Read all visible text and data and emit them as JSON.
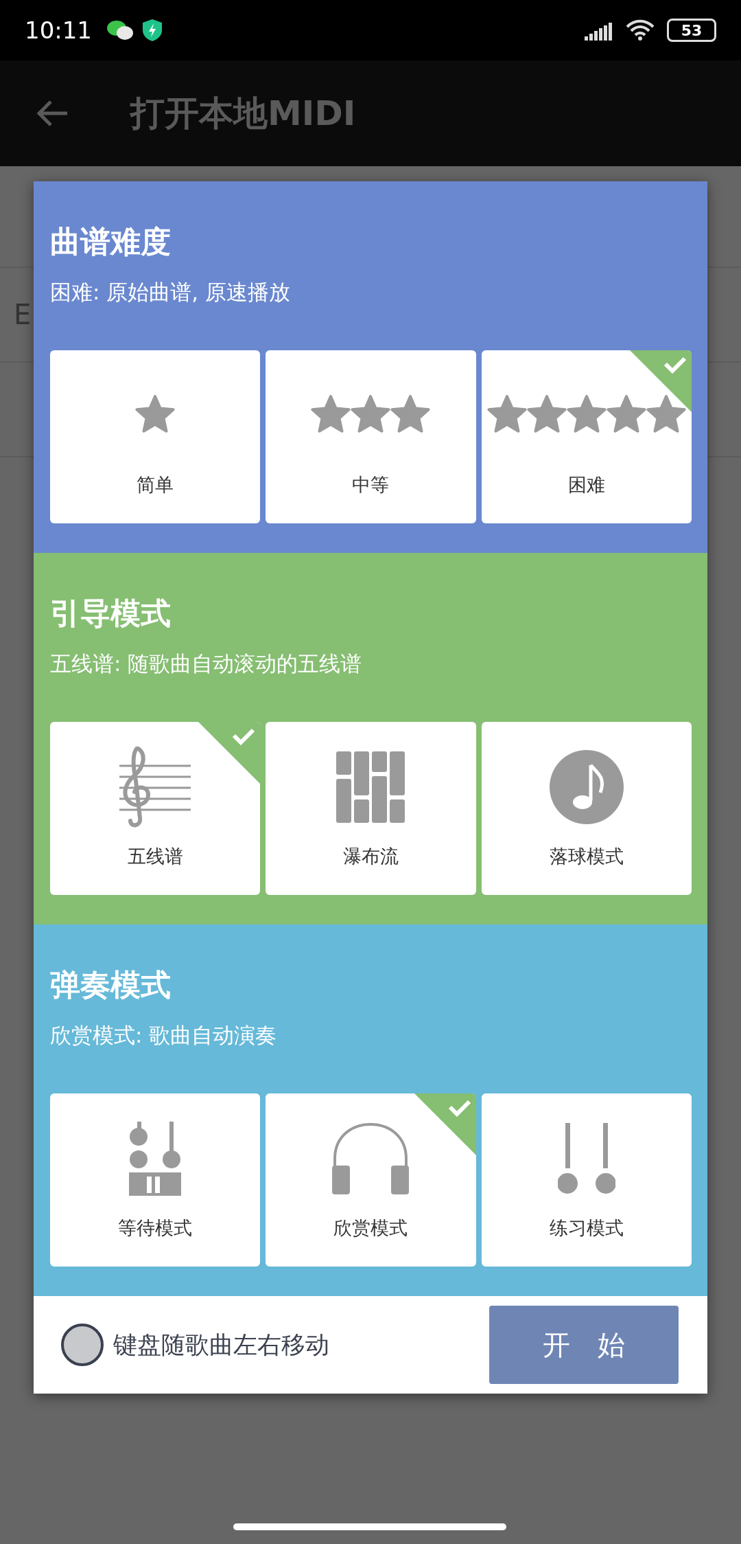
{
  "status_bar": {
    "time": "10:11",
    "battery": "53"
  },
  "app_bar": {
    "title": "打开本地MIDI"
  },
  "background_list": [
    {
      "text": "E"
    }
  ],
  "dialog": {
    "sections": [
      {
        "title": "曲谱难度",
        "description": "困难: 原始曲谱, 原速播放",
        "color": "#6a88cf",
        "options": [
          {
            "label": "简单",
            "kind": "onestar",
            "selected": false
          },
          {
            "label": "中等",
            "kind": "threestars",
            "selected": false
          },
          {
            "label": "困难",
            "kind": "fivestars",
            "selected": true
          }
        ]
      },
      {
        "title": "引导模式",
        "description": "五线谱: 随歌曲自动滚动的五线谱",
        "color": "#86be72",
        "options": [
          {
            "label": "五线谱",
            "kind": "staff",
            "selected": true
          },
          {
            "label": "瀑布流",
            "kind": "waterfall",
            "selected": false
          },
          {
            "label": "落球模式",
            "kind": "ball",
            "selected": false
          }
        ]
      },
      {
        "title": "弹奏模式",
        "description": "欣赏模式: 歌曲自动演奏",
        "color": "#66b9d8",
        "options": [
          {
            "label": "等待模式",
            "kind": "wait",
            "selected": false
          },
          {
            "label": "欣赏模式",
            "kind": "listen",
            "selected": true
          },
          {
            "label": "练习模式",
            "kind": "practice",
            "selected": false
          }
        ]
      }
    ],
    "toggle": {
      "label": "键盘随歌曲左右移动",
      "checked": false
    },
    "start_button": "开　始"
  }
}
